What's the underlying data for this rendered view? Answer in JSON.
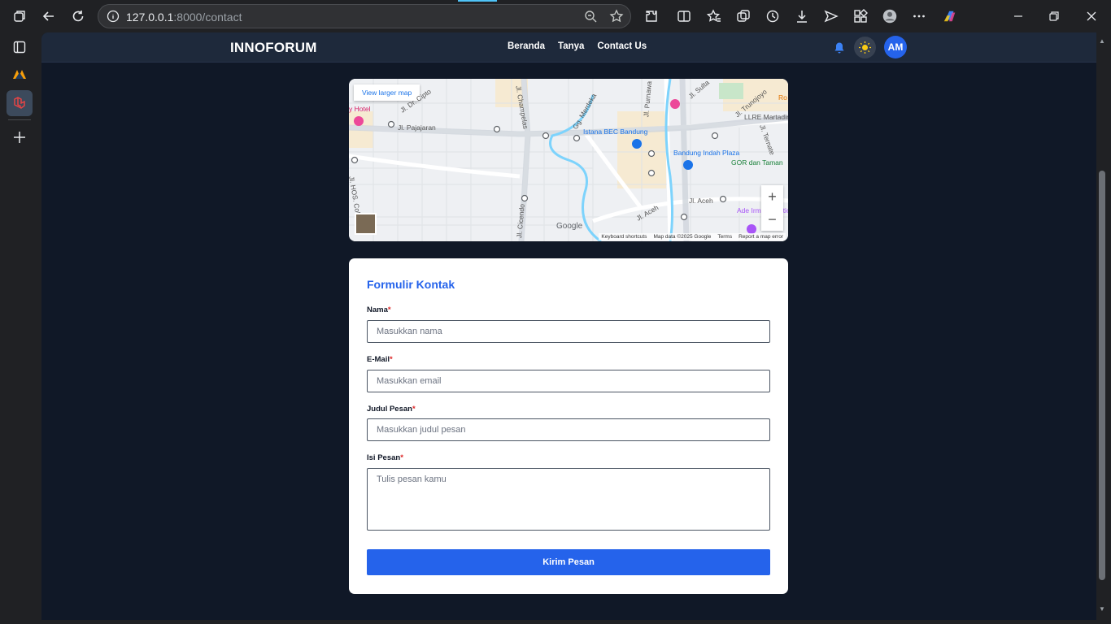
{
  "browser": {
    "url_host": "127.0.0.1",
    "url_rest": ":8000/contact"
  },
  "navbar": {
    "brand": "INNOFORUM",
    "links": [
      "Beranda",
      "Tanya",
      "Contact Us"
    ],
    "avatar_initials": "AM"
  },
  "map": {
    "view_larger": "View larger map",
    "labels": {
      "hotel": "y Hotel",
      "pajajaran": "Jl. Pajajaran",
      "cipto": "Jl. Dr. Cipto",
      "champelas": "Jl. Champelas",
      "istana": "Istana BEC Bandung",
      "bip": "Bandung Indah Plaza",
      "gor": "GOR dan Taman",
      "aceh": "Jl. Aceh",
      "ade": "Ade Irma Nasutio",
      "martadinata": "LLRE Martadin",
      "hos": "Jl. HOS. Coki",
      "cicendo": "Jl. Cicendo",
      "trunojoyo": "Jl. Trunojoyo",
      "purnawarman": "Jl. Purnawa",
      "ro": "Ro",
      "ternate": "Jl. Ternate",
      "sultan": "Jl. Sulta",
      "merdeka": "Gg. Merdeka"
    },
    "google": "Google",
    "footer": [
      "Keyboard shortcuts",
      "Map data ©2025 Google",
      "Terms",
      "Report a map error"
    ],
    "zoom_in": "+",
    "zoom_out": "−"
  },
  "form": {
    "title": "Formulir Kontak",
    "fields": [
      {
        "label": "Nama",
        "placeholder": "Masukkan nama"
      },
      {
        "label": "E-Mail",
        "placeholder": "Masukkan email"
      },
      {
        "label": "Judul Pesan",
        "placeholder": "Masukkan judul pesan"
      },
      {
        "label": "Isi Pesan",
        "placeholder": "Tulis pesan kamu"
      }
    ],
    "required_mark": "*",
    "submit_label": "Kirim Pesan"
  },
  "colors": {
    "accent": "#2563eb",
    "page_bg": "#101827",
    "navbar_bg": "#1e293b"
  }
}
